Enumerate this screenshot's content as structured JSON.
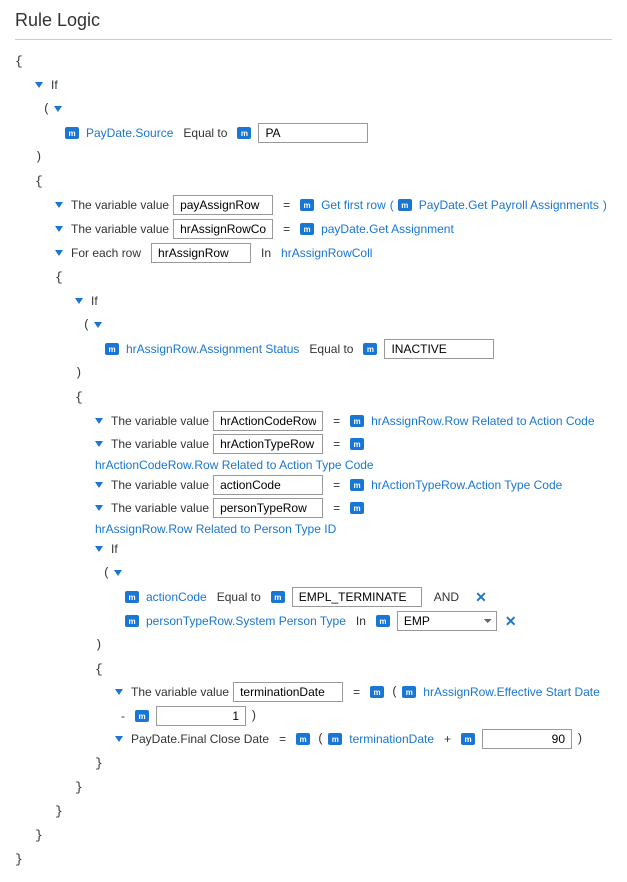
{
  "title": "Rule Logic",
  "kw": {
    "if": "If",
    "forEach": "For each row",
    "in": "In",
    "varValue": "The variable value",
    "equalTo": "Equal to",
    "inOp": "In",
    "and": "AND",
    "eq": "=",
    "plus": "+",
    "minus": "-"
  },
  "expr": {
    "payDateSource": "PayDate.Source",
    "pa": "PA",
    "payAssignRow": "payAssignRow",
    "getFirstRow": "Get first row",
    "getPayrollAssign": "PayDate.Get Payroll Assignments",
    "hrAssignRowColl": "hrAssignRowColl",
    "payDateGetAssign": "payDate.Get Assignment",
    "hrAssignRow": "hrAssignRow",
    "assignStatus": "hrAssignRow.Assignment Status",
    "inactive": "INACTIVE",
    "hrActionCodeRow": "hrActionCodeRow",
    "rowActionCode": "hrAssignRow.Row Related to Action Code",
    "hrActionTypeRow": "hrActionTypeRow",
    "rowActionTypeCode": "hrActionCodeRow.Row Related to Action Type Code",
    "actionCode": "actionCode",
    "actionTypeCode": "hrActionTypeRow.Action Type Code",
    "personTypeRow": "personTypeRow",
    "rowPersonType": "hrAssignRow.Row Related to Person Type ID",
    "emplTerminate": "EMPL_TERMINATE",
    "sysPersonType": "personTypeRow.System Person Type",
    "emp": "EMP",
    "terminationDate": "terminationDate",
    "effStartDate": "hrAssignRow.Effective Start Date",
    "one": "1",
    "finalCloseDate": "PayDate.Final Close Date",
    "ninety": "90"
  }
}
